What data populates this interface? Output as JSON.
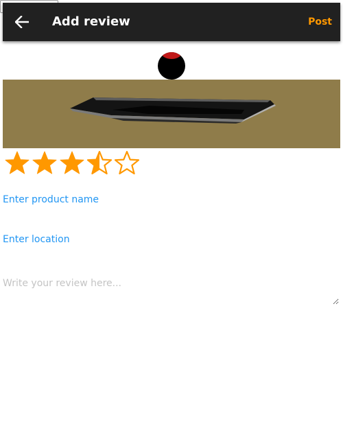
{
  "header": {
    "title": "Add review",
    "back_icon": "arrow-left-icon",
    "post_label": "Post",
    "background_color": "#212121",
    "post_color": "#ff9800"
  },
  "rating": {
    "value": 3.5,
    "max": 5,
    "star_color": "#ff9800"
  },
  "form": {
    "product_name_label": "Enter product name",
    "location_label": "Enter location",
    "review_placeholder": "Write your review here...",
    "label_color": "#2196f3"
  }
}
